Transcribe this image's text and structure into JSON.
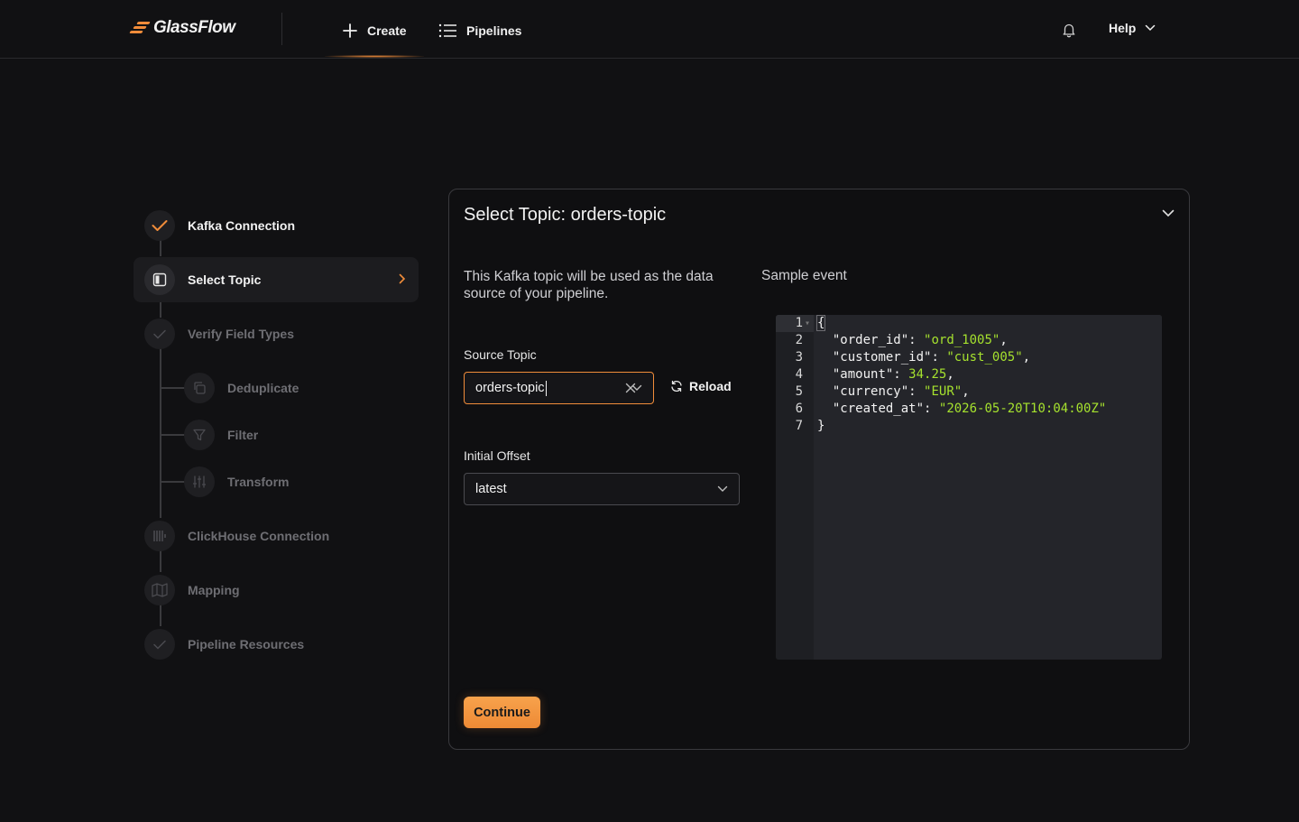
{
  "header": {
    "logo_text": "GlassFlow",
    "nav": {
      "create": "Create",
      "pipelines": "Pipelines"
    },
    "help": "Help"
  },
  "stepper": {
    "steps": [
      {
        "label": "Kafka Connection",
        "state": "done",
        "icon": "check-icon"
      },
      {
        "label": "Select Topic",
        "state": "active",
        "icon": "panel-icon"
      },
      {
        "label": "Verify Field Types",
        "state": "pending",
        "icon": "check-icon"
      },
      {
        "label": "Deduplicate",
        "state": "pending",
        "icon": "copy-icon"
      },
      {
        "label": "Filter",
        "state": "pending",
        "icon": "filter-icon"
      },
      {
        "label": "Transform",
        "state": "pending",
        "icon": "sliders-icon"
      },
      {
        "label": "ClickHouse Connection",
        "state": "pending",
        "icon": "database-icon"
      },
      {
        "label": "Mapping",
        "state": "pending",
        "icon": "map-icon"
      },
      {
        "label": "Pipeline Resources",
        "state": "pending",
        "icon": "check-icon"
      }
    ]
  },
  "card": {
    "title": "Select Topic: orders-topic",
    "description": "This Kafka topic will be used as the data source of your pipeline.",
    "sample_label": "Sample event",
    "source_topic": {
      "label": "Source Topic",
      "value": "orders-topic"
    },
    "reload_label": "Reload",
    "initial_offset": {
      "label": "Initial Offset",
      "value": "latest"
    },
    "continue_label": "Continue"
  },
  "sample_event": {
    "line_numbers": [
      "1",
      "2",
      "3",
      "4",
      "5",
      "6",
      "7"
    ],
    "fields": [
      {
        "key": "order_id",
        "value": "ord_1005",
        "type": "string"
      },
      {
        "key": "customer_id",
        "value": "cust_005",
        "type": "string"
      },
      {
        "key": "amount",
        "value": "34.25",
        "type": "number"
      },
      {
        "key": "currency",
        "value": "EUR",
        "type": "string"
      },
      {
        "key": "created_at",
        "value": "2026-05-20T10:04:00Z",
        "type": "string"
      }
    ],
    "open_brace": "{",
    "close_brace": "}"
  },
  "colors": {
    "accent": "#f08c3a",
    "background": "#111113",
    "code_string": "#a6e22e"
  }
}
